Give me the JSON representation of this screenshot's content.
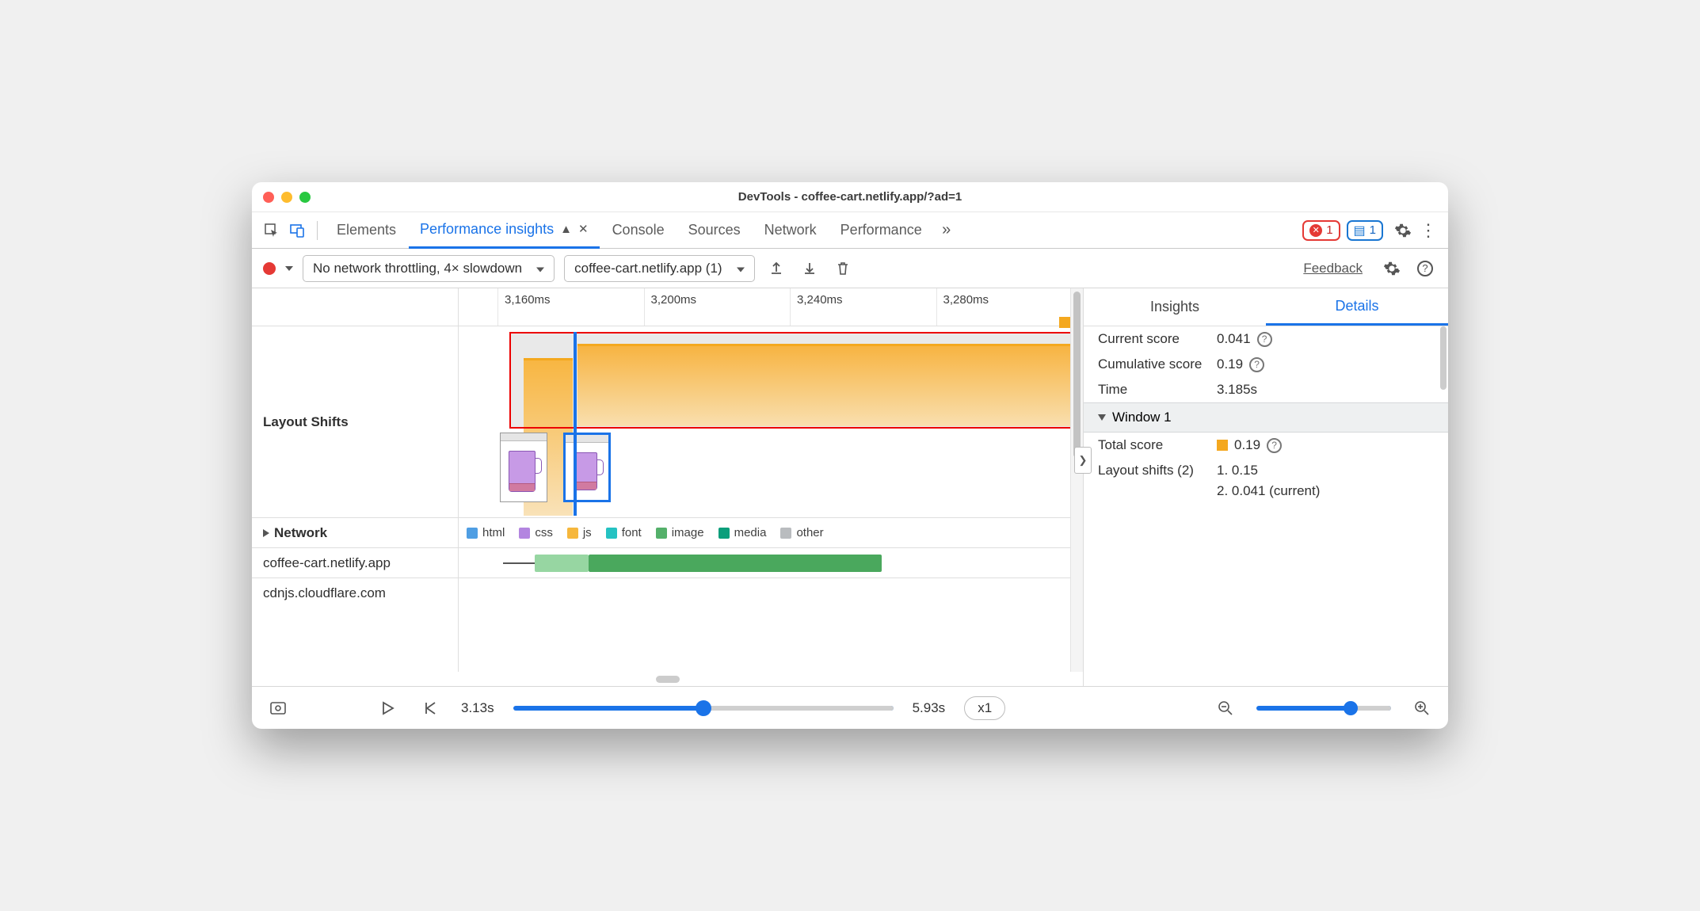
{
  "window": {
    "title": "DevTools - coffee-cart.netlify.app/?ad=1"
  },
  "tabs": {
    "items": [
      "Elements",
      "Performance insights",
      "Console",
      "Sources",
      "Network",
      "Performance"
    ],
    "active": "Performance insights",
    "errors_count": "1",
    "info_count": "1"
  },
  "toolbar": {
    "throttling": "No network throttling, 4× slowdown",
    "recording": "coffee-cart.netlify.app (1)",
    "feedback": "Feedback"
  },
  "timeline": {
    "ticks": [
      "3,160ms",
      "3,200ms",
      "3,240ms",
      "3,280ms"
    ],
    "layout_label": "Layout Shifts",
    "network_label": "Network",
    "hosts": [
      "coffee-cart.netlify.app",
      "cdnjs.cloudflare.com"
    ],
    "legend": [
      {
        "label": "html",
        "color": "#4f9ee3"
      },
      {
        "label": "css",
        "color": "#b385e0"
      },
      {
        "label": "js",
        "color": "#f6b73c"
      },
      {
        "label": "font",
        "color": "#25c2c2"
      },
      {
        "label": "image",
        "color": "#54b06a"
      },
      {
        "label": "media",
        "color": "#0b9e7b"
      },
      {
        "label": "other",
        "color": "#b9bcbf"
      }
    ]
  },
  "side": {
    "tabs": [
      "Insights",
      "Details"
    ],
    "active": "Details",
    "current_score_label": "Current score",
    "current_score": "0.041",
    "cumulative_label": "Cumulative score",
    "cumulative": "0.19",
    "time_label": "Time",
    "time": "3.185s",
    "window_section": "Window 1",
    "total_score_label": "Total score",
    "total_score": "0.19",
    "shifts_label": "Layout shifts (2)",
    "shifts": [
      "1. 0.15",
      "2. 0.041 (current)"
    ]
  },
  "footer": {
    "start": "3.13s",
    "end": "5.93s",
    "speed": "x1"
  }
}
